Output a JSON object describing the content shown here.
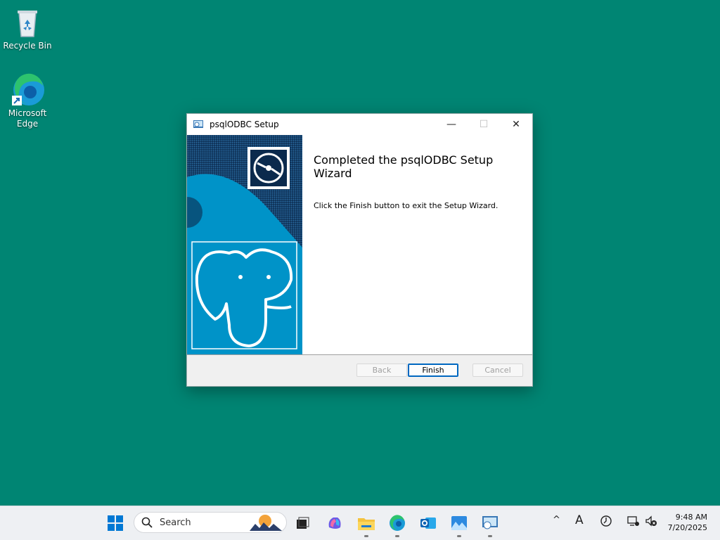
{
  "desktop": {
    "icons": [
      {
        "label": "Recycle Bin"
      },
      {
        "label": "Microsoft Edge"
      }
    ]
  },
  "dialog": {
    "title": "psqlODBC Setup",
    "heading": "Completed the psqlODBC Setup Wizard",
    "body": "Click the Finish button to exit the Setup Wizard.",
    "buttons": {
      "back": "Back",
      "finish": "Finish",
      "cancel": "Cancel"
    },
    "window_controls": {
      "minimize": "—",
      "maximize": "☐",
      "close": "✕"
    }
  },
  "taskbar": {
    "search_label": "Search",
    "clock": {
      "time": "9:48 AM",
      "date": "7/20/2025"
    },
    "apps": [
      "start-icon",
      "search-icon",
      "task-view-icon",
      "copilot-icon",
      "file-explorer-icon",
      "edge-icon",
      "outlook-icon",
      "photos-icon",
      "setup-icon"
    ],
    "tray": {
      "chevron": "^",
      "ime": "A"
    }
  },
  "colors": {
    "desktop": "#008573",
    "accent": "#0067c0",
    "banner": "#0093c8"
  }
}
